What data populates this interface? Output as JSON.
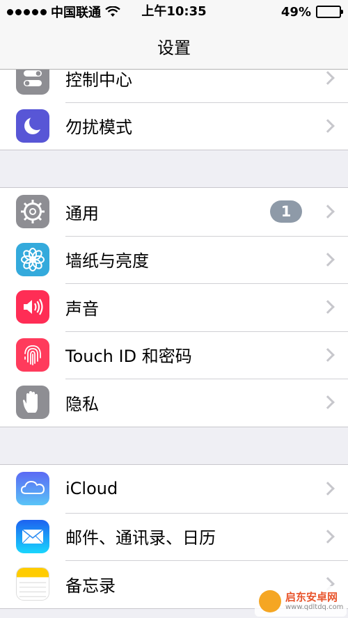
{
  "status_bar": {
    "carrier": "中国联通",
    "time": "上午10:35",
    "battery": "49%",
    "battery_level": 0.49
  },
  "nav": {
    "title": "设置"
  },
  "groups": [
    {
      "items": [
        {
          "label": "控制中心",
          "icon": "control-center-icon",
          "icon_color": "#8e8e93"
        },
        {
          "label": "勿扰模式",
          "icon": "moon-icon",
          "icon_color": "#5856d6"
        }
      ]
    },
    {
      "items": [
        {
          "label": "通用",
          "icon": "gear-icon",
          "icon_color": "#8e8e93",
          "badge": "1"
        },
        {
          "label": "墙纸与亮度",
          "icon": "flower-icon",
          "icon_color": "#34aadc"
        },
        {
          "label": "声音",
          "icon": "speaker-icon",
          "icon_color": "#ff2d55"
        },
        {
          "label": "Touch ID 和密码",
          "icon": "fingerprint-icon",
          "icon_color": "#ff3b5c"
        },
        {
          "label": "隐私",
          "icon": "hand-icon",
          "icon_color": "#8e8e93"
        }
      ]
    },
    {
      "items": [
        {
          "label": "iCloud",
          "icon": "cloud-icon",
          "icon_color": "#5ac8fa"
        },
        {
          "label": "邮件、通讯录、日历",
          "icon": "mail-icon",
          "icon_color": "#1a8cff"
        },
        {
          "label": "备忘录",
          "icon": "notes-icon",
          "icon_color": "#ffcc00"
        }
      ]
    }
  ],
  "watermark": {
    "title": "启东安卓网",
    "url": "www.qdltdq.com"
  }
}
